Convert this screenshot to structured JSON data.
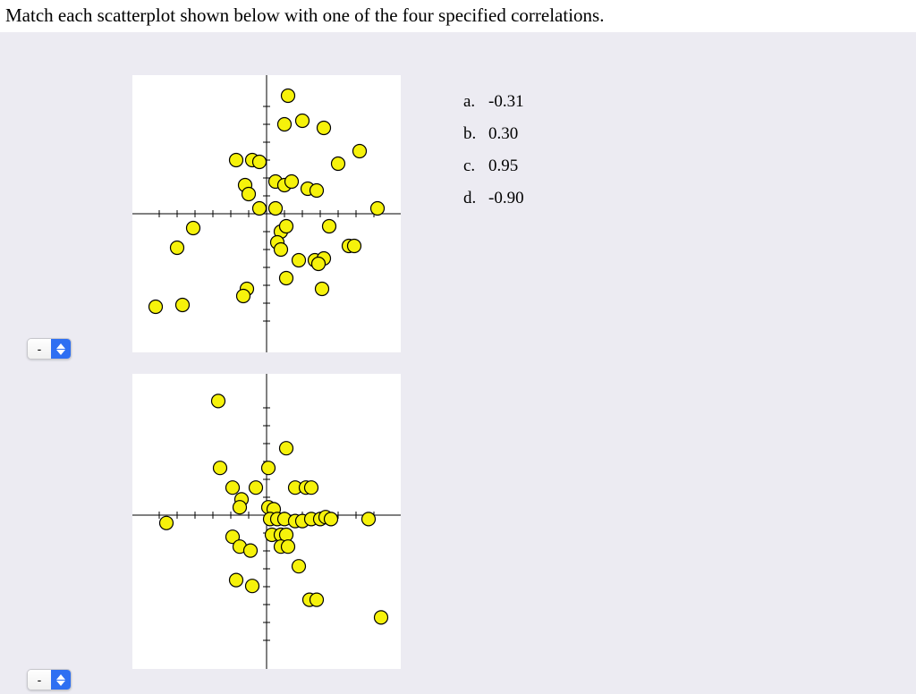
{
  "question": "Match each scatterplot shown below with one of the four specified correlations.",
  "answers": {
    "a": {
      "letter": "a.",
      "value": "-0.31"
    },
    "b": {
      "letter": "b.",
      "value": "0.30"
    },
    "c": {
      "letter": "c.",
      "value": "0.95"
    },
    "d": {
      "letter": "d.",
      "value": "-0.90"
    }
  },
  "selectors": {
    "sel1": "-",
    "sel2": "-"
  },
  "chart_data": [
    {
      "type": "scatter",
      "title": "",
      "xlabel": "",
      "ylabel": "",
      "xlim": [
        -7,
        7
      ],
      "ylim": [
        -7,
        7
      ],
      "points": [
        [
          1.2,
          6.6
        ],
        [
          1.0,
          5.0
        ],
        [
          2.0,
          5.2
        ],
        [
          3.2,
          4.8
        ],
        [
          5.2,
          3.5
        ],
        [
          -1.7,
          3.0
        ],
        [
          -0.8,
          3.0
        ],
        [
          -0.4,
          2.9
        ],
        [
          4.0,
          2.8
        ],
        [
          -1.2,
          1.6
        ],
        [
          -1.0,
          1.1
        ],
        [
          0.5,
          1.8
        ],
        [
          1.0,
          1.6
        ],
        [
          1.4,
          1.8
        ],
        [
          2.3,
          1.4
        ],
        [
          2.8,
          1.3
        ],
        [
          -0.4,
          0.3
        ],
        [
          0.5,
          0.3
        ],
        [
          6.2,
          0.3
        ],
        [
          -4.1,
          -0.8
        ],
        [
          0.8,
          -1.0
        ],
        [
          1.1,
          -0.7
        ],
        [
          3.5,
          -0.7
        ],
        [
          -5.0,
          -1.9
        ],
        [
          0.6,
          -1.6
        ],
        [
          0.8,
          -2.0
        ],
        [
          4.6,
          -1.8
        ],
        [
          4.9,
          -1.8
        ],
        [
          1.8,
          -2.6
        ],
        [
          2.7,
          -2.6
        ],
        [
          3.2,
          -2.5
        ],
        [
          2.9,
          -2.8
        ],
        [
          1.1,
          -3.6
        ],
        [
          3.1,
          -4.2
        ],
        [
          -1.1,
          -4.2
        ],
        [
          -1.3,
          -4.6
        ],
        [
          -6.2,
          -5.2
        ],
        [
          -4.7,
          -5.1
        ]
      ]
    },
    {
      "type": "scatter",
      "title": "",
      "xlabel": "",
      "ylabel": "",
      "xlim": [
        -7,
        7
      ],
      "ylim": [
        -7,
        7
      ],
      "points": [
        [
          -2.7,
          5.8
        ],
        [
          1.1,
          3.4
        ],
        [
          -2.6,
          2.4
        ],
        [
          0.1,
          2.4
        ],
        [
          -1.9,
          1.4
        ],
        [
          -0.6,
          1.4
        ],
        [
          1.6,
          1.4
        ],
        [
          2.2,
          1.4
        ],
        [
          2.5,
          1.4
        ],
        [
          -1.4,
          0.8
        ],
        [
          -1.5,
          0.4
        ],
        [
          0.1,
          0.4
        ],
        [
          0.4,
          0.3
        ],
        [
          -5.6,
          -0.4
        ],
        [
          0.2,
          -0.2
        ],
        [
          0.6,
          -0.2
        ],
        [
          1.0,
          -0.2
        ],
        [
          1.6,
          -0.3
        ],
        [
          2.0,
          -0.3
        ],
        [
          2.5,
          -0.2
        ],
        [
          3.0,
          -0.2
        ],
        [
          3.3,
          -0.1
        ],
        [
          3.6,
          -0.2
        ],
        [
          5.7,
          -0.2
        ],
        [
          -1.9,
          -1.1
        ],
        [
          0.3,
          -1.0
        ],
        [
          0.8,
          -1.0
        ],
        [
          1.1,
          -1.0
        ],
        [
          -1.5,
          -1.6
        ],
        [
          -0.9,
          -1.8
        ],
        [
          0.8,
          -1.6
        ],
        [
          1.2,
          -1.6
        ],
        [
          1.8,
          -2.6
        ],
        [
          -1.7,
          -3.3
        ],
        [
          -0.8,
          -3.6
        ],
        [
          2.4,
          -4.3
        ],
        [
          2.8,
          -4.3
        ],
        [
          6.4,
          -5.2
        ]
      ]
    }
  ]
}
